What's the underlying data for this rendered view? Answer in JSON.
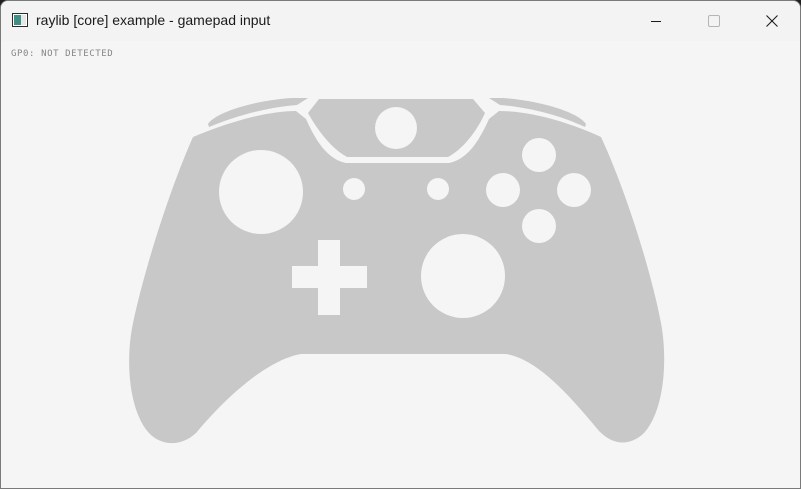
{
  "window": {
    "title": "raylib [core] example - gamepad input",
    "icon": "raylib-window-icon",
    "controls": [
      "minimize-icon",
      "maximize-icon",
      "close-icon"
    ]
  },
  "canvas": {
    "background": "#f5f5f5",
    "status": "GP0: NOT DETECTED"
  },
  "gamepad": {
    "type": "xbox-controller",
    "color": "#c8c8c8",
    "button_color": "#f5f5f5"
  }
}
